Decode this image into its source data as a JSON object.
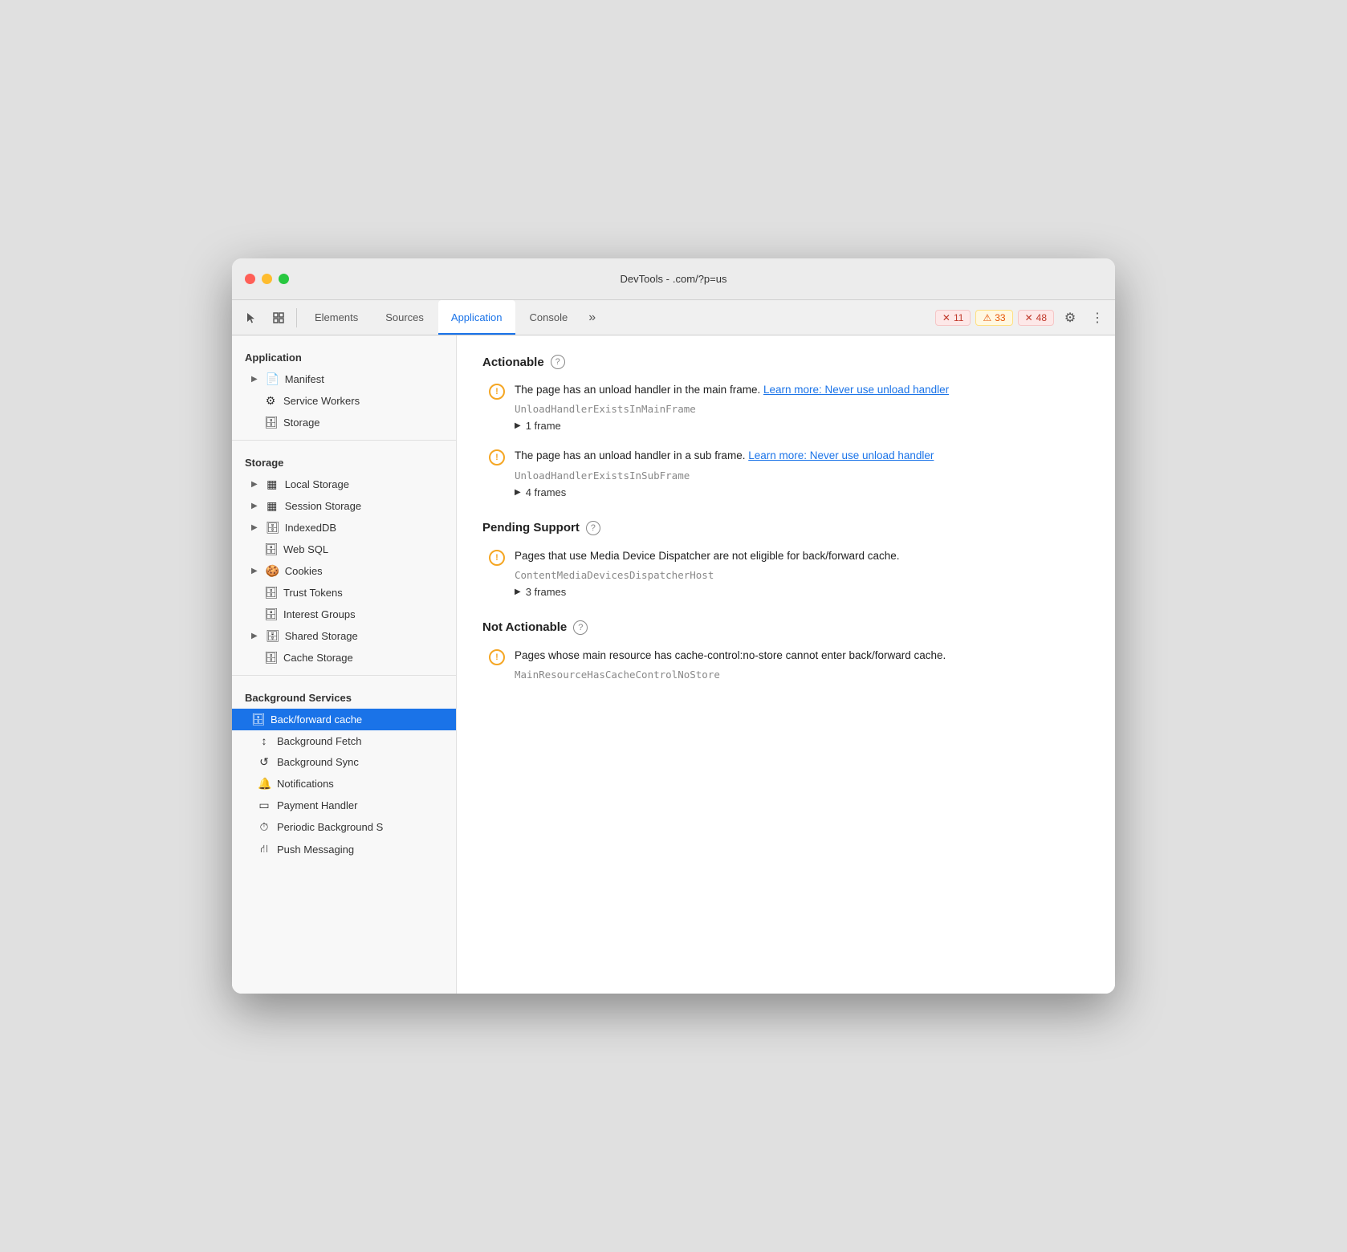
{
  "window": {
    "title_left": "DevTools -",
    "title_right": ".com/?p=us"
  },
  "tabs": {
    "items": [
      "Elements",
      "Sources",
      "Application",
      "Console"
    ],
    "active": "Application",
    "overflow": "»"
  },
  "badges": {
    "error": {
      "icon": "✕",
      "count": "11"
    },
    "warning": {
      "icon": "⚠",
      "count": "33"
    },
    "info": {
      "icon": "✕",
      "count": "48"
    }
  },
  "sidebar": {
    "app_section": "Application",
    "app_items": [
      {
        "id": "manifest",
        "label": "Manifest",
        "icon": "📄",
        "indent": true,
        "arrow": true
      },
      {
        "id": "service-workers",
        "label": "Service Workers",
        "icon": "⚙",
        "indent": false
      },
      {
        "id": "storage-app",
        "label": "Storage",
        "icon": "🗄",
        "indent": false
      }
    ],
    "storage_section": "Storage",
    "storage_items": [
      {
        "id": "local-storage",
        "label": "Local Storage",
        "icon": "▦",
        "arrow": true
      },
      {
        "id": "session-storage",
        "label": "Session Storage",
        "icon": "▦",
        "arrow": true
      },
      {
        "id": "indexeddb",
        "label": "IndexedDB",
        "icon": "🗄",
        "arrow": true
      },
      {
        "id": "web-sql",
        "label": "Web SQL",
        "icon": "🗄",
        "arrow": false
      },
      {
        "id": "cookies",
        "label": "Cookies",
        "icon": "🍪",
        "arrow": true
      },
      {
        "id": "trust-tokens",
        "label": "Trust Tokens",
        "icon": "🗄",
        "arrow": false
      },
      {
        "id": "interest-groups",
        "label": "Interest Groups",
        "icon": "🗄",
        "arrow": false
      },
      {
        "id": "shared-storage",
        "label": "Shared Storage",
        "icon": "🗄",
        "arrow": true
      },
      {
        "id": "cache-storage",
        "label": "Cache Storage",
        "icon": "🗄",
        "arrow": false
      }
    ],
    "bg_section": "Background Services",
    "bg_items": [
      {
        "id": "back-forward-cache",
        "label": "Back/forward cache",
        "icon": "🗄",
        "active": true
      },
      {
        "id": "background-fetch",
        "label": "Background Fetch",
        "icon": "↕",
        "active": false
      },
      {
        "id": "background-sync",
        "label": "Background Sync",
        "icon": "↺",
        "active": false
      },
      {
        "id": "notifications",
        "label": "Notifications",
        "icon": "🔔",
        "active": false
      },
      {
        "id": "payment-handler",
        "label": "Payment Handler",
        "icon": "▭",
        "active": false
      },
      {
        "id": "periodic-background",
        "label": "Periodic Background S",
        "icon": "⏱",
        "active": false
      },
      {
        "id": "push-messaging",
        "label": "Push Messaging",
        "icon": "⛙",
        "active": false
      }
    ]
  },
  "content": {
    "sections": [
      {
        "id": "actionable",
        "title": "Actionable",
        "issues": [
          {
            "id": "issue-1",
            "text": "The page has an unload handler in the main frame.",
            "link_text": "Learn more: Never use unload handler",
            "code": "UnloadHandlerExistsInMainFrame",
            "frames": "1 frame"
          },
          {
            "id": "issue-2",
            "text": "The page has an unload handler in a sub frame.",
            "link_text": "Learn more: Never use unload handler",
            "code": "UnloadHandlerExistsInSubFrame",
            "frames": "4 frames"
          }
        ]
      },
      {
        "id": "pending-support",
        "title": "Pending Support",
        "issues": [
          {
            "id": "issue-3",
            "text": "Pages that use Media Device Dispatcher are not eligible for back/forward cache.",
            "link_text": "",
            "code": "ContentMediaDevicesDispatcherHost",
            "frames": "3 frames"
          }
        ]
      },
      {
        "id": "not-actionable",
        "title": "Not Actionable",
        "issues": [
          {
            "id": "issue-4",
            "text": "Pages whose main resource has cache-control:no-store cannot enter back/forward cache.",
            "link_text": "",
            "code": "MainResourceHasCacheControlNoStore",
            "frames": ""
          }
        ]
      }
    ]
  }
}
